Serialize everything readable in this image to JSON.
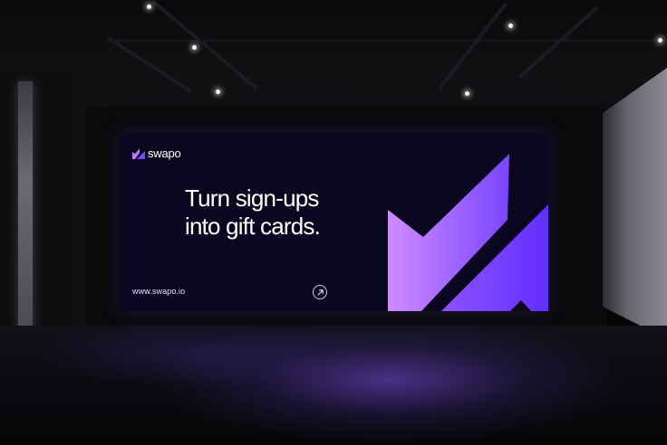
{
  "billboard": {
    "brand": "swapo",
    "headline": [
      "Turn sign-ups",
      "into gift cards."
    ],
    "url": "www.swapo.io",
    "arrow_icon": "arrow-up-right-icon",
    "logo_icon": "swapo-logo-mark-icon"
  },
  "colors": {
    "billboard_background": "#0b0720",
    "accent_light": "#cf8cff",
    "accent_mid": "#9a5cff",
    "accent_dark": "#6c3cff",
    "text": "#ffffff"
  }
}
